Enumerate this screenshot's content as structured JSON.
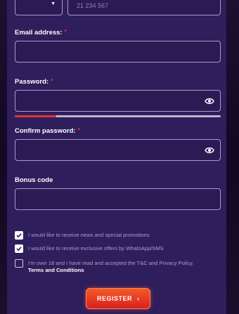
{
  "phone": {
    "value": "21 234 567"
  },
  "email": {
    "label": "Email address:",
    "required_mark": "*",
    "value": ""
  },
  "password": {
    "label": "Password:",
    "required_mark": "*",
    "value": "",
    "strength_fraction": 0.2,
    "icon": "eye-icon"
  },
  "confirm_password": {
    "label": "Confirm password:",
    "required_mark": "*",
    "value": "",
    "icon": "eye-icon"
  },
  "bonus_code": {
    "label": "Bonus code",
    "value": ""
  },
  "consents": [
    {
      "text": "I would like to receive news and special promotions",
      "checked": true
    },
    {
      "text": "I would like to receive exclusive offers by WhatsApp/SMS",
      "checked": true
    },
    {
      "text": "I'm over 18 and I have read and accepted the T&C and Privacy Policy.",
      "link": "Terms and Conditions",
      "checked": false
    }
  ],
  "register_button": {
    "label": "REGISTER",
    "chevron": "›"
  },
  "colors": {
    "panel_bg": "#2f1e5c",
    "input_border": "#a79bc9",
    "required": "#e23a3a",
    "strength_weak": "#e03434",
    "button_top": "#f45a2a",
    "button_bottom": "#d9201e"
  }
}
